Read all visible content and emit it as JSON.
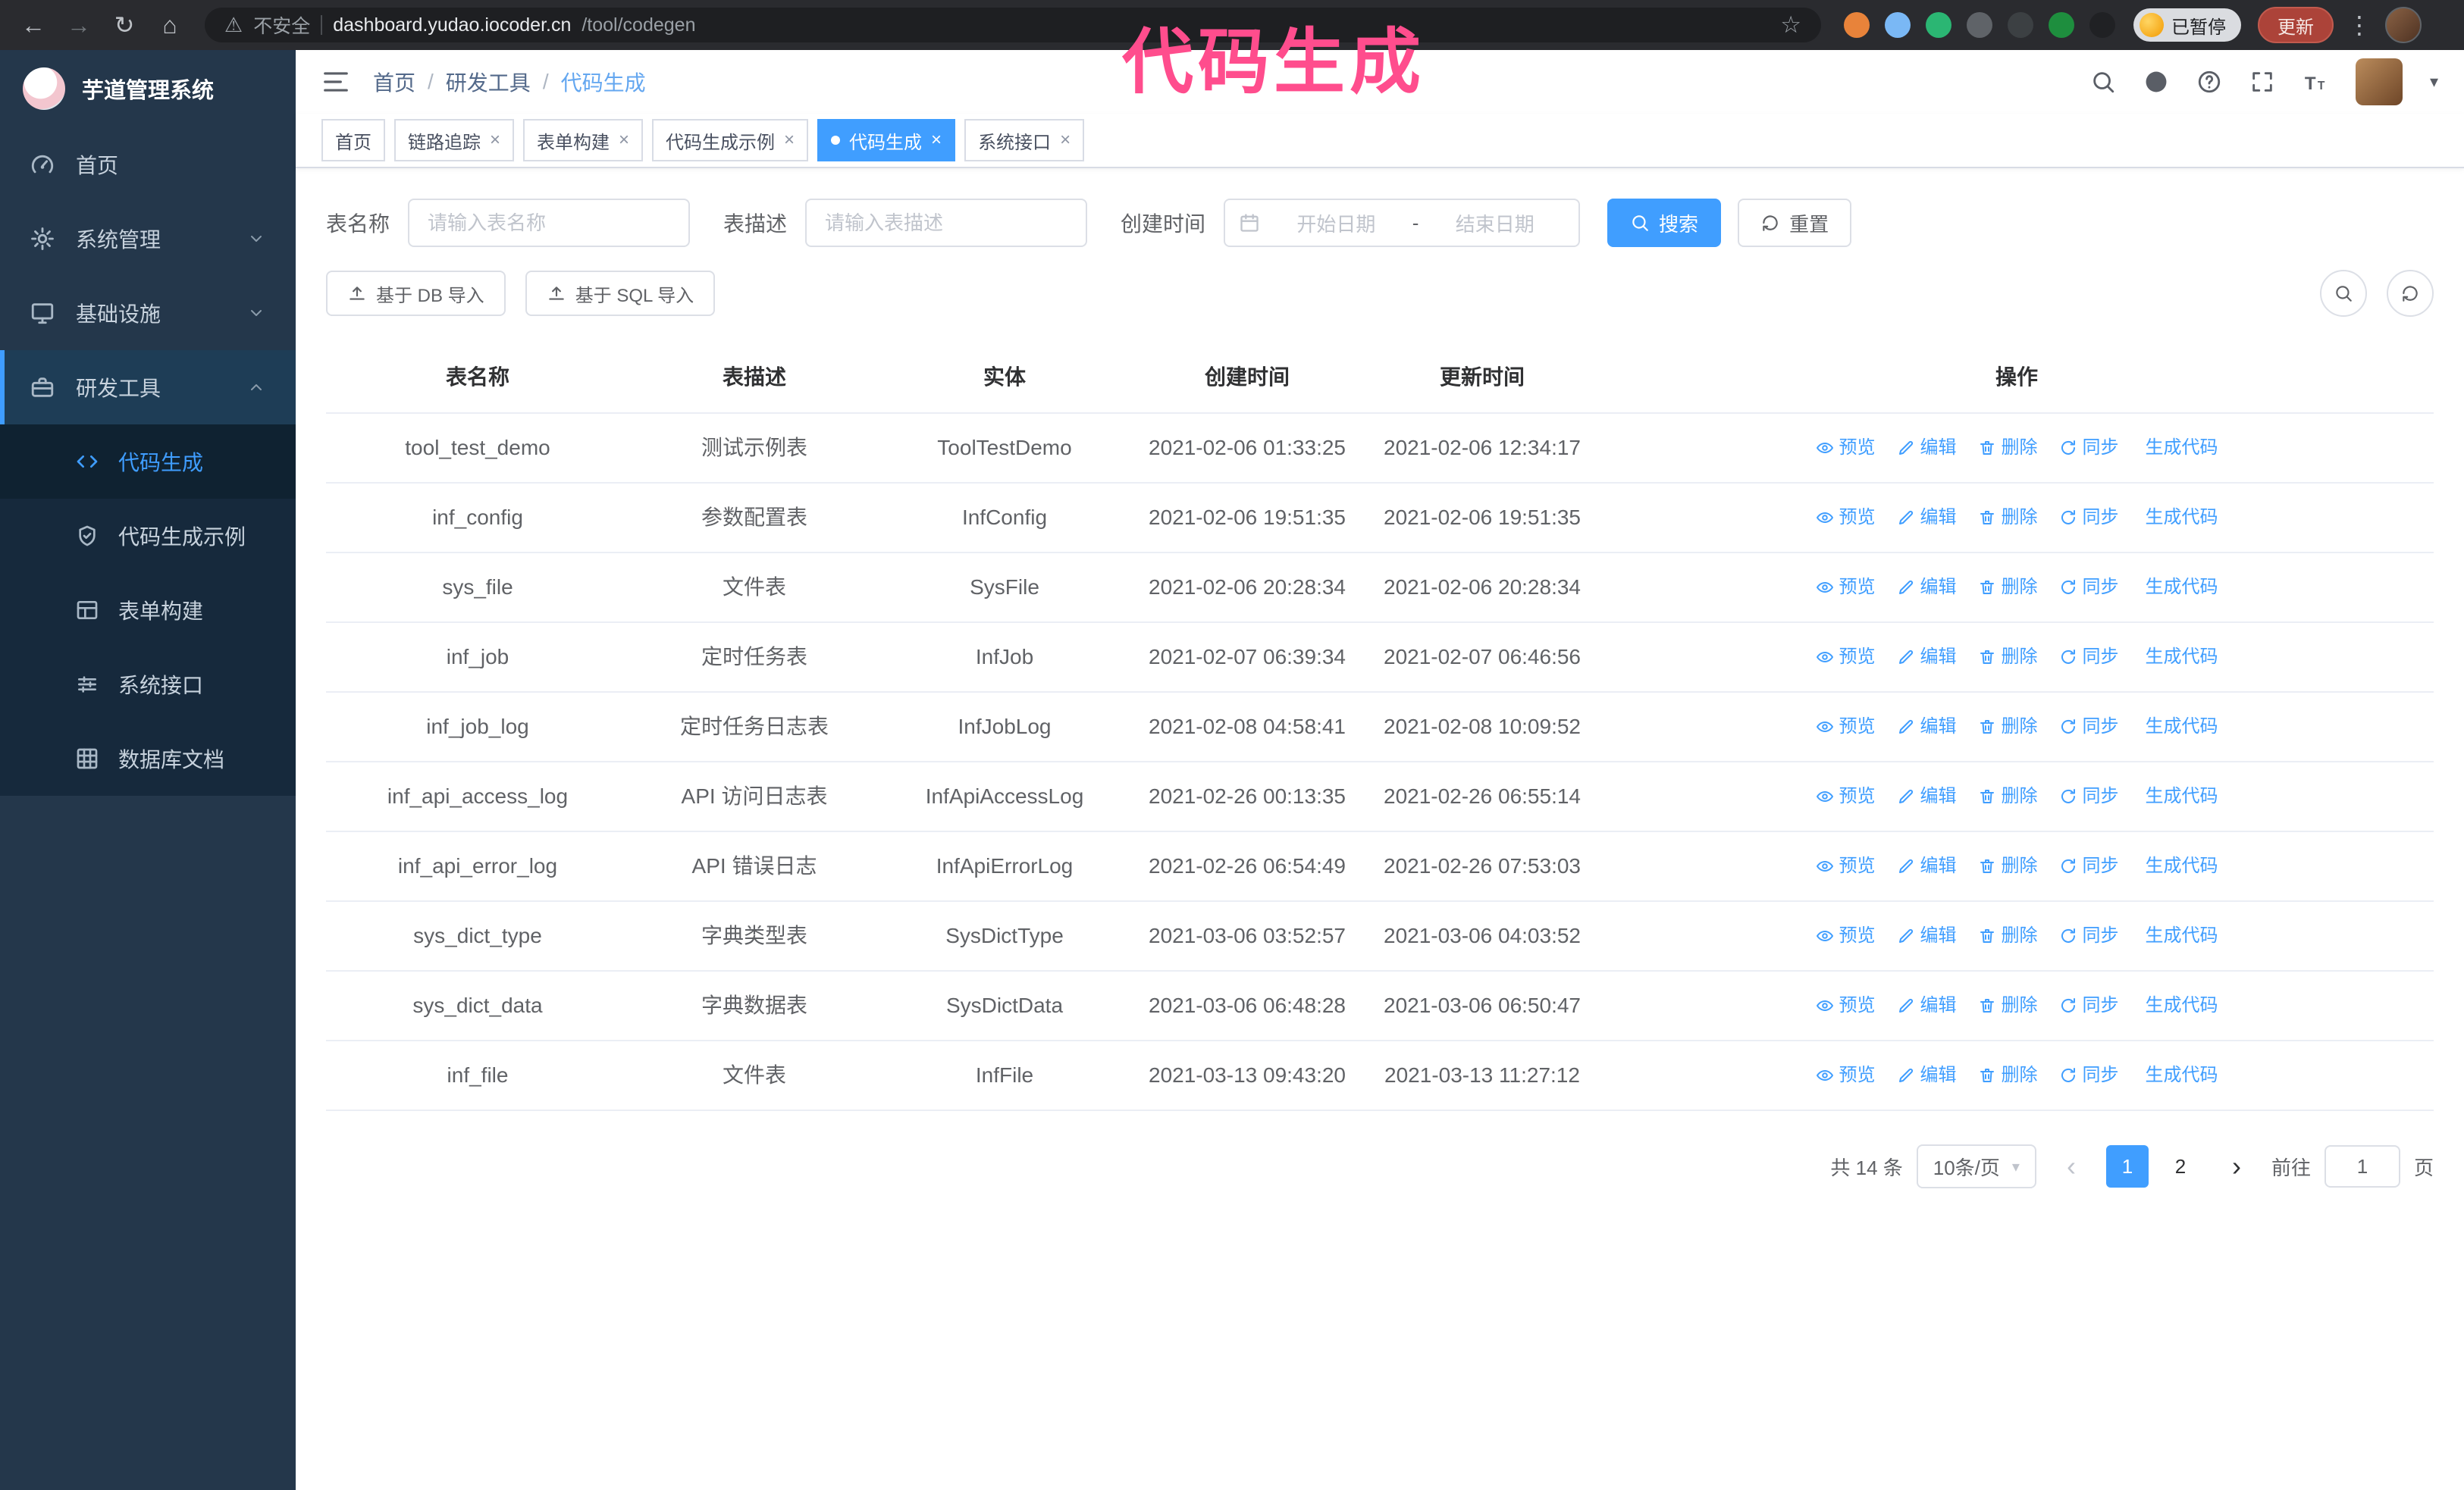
{
  "browser": {
    "nav_icons": [
      "back",
      "forward",
      "reload",
      "home"
    ],
    "security_label": "不安全",
    "url_host": "dashboard.yudao.iocoder.cn",
    "url_path": "/tool/codegen",
    "extensions": [
      {
        "name": "extension-orange",
        "color": "#e8833a"
      },
      {
        "name": "extension-lightblue",
        "color": "#7ab8f5"
      },
      {
        "name": "extension-green-check",
        "color": "#2bb673"
      },
      {
        "name": "extension-grid",
        "color": "#5f6368"
      },
      {
        "name": "extension-dark",
        "color": "#3c4043"
      },
      {
        "name": "extension-leaf",
        "color": "#1e8e3e"
      },
      {
        "name": "extension-pin",
        "color": "#202124"
      }
    ],
    "paused_badge": "已暂停",
    "update_button": "更新"
  },
  "overlay_title": "代码生成",
  "sidebar": {
    "logo_title": "芋道管理系统",
    "items": [
      {
        "label": "首页",
        "icon": "gauge"
      },
      {
        "label": "系统管理",
        "icon": "gear",
        "chevron": "down"
      },
      {
        "label": "基础设施",
        "icon": "monitor",
        "chevron": "down"
      },
      {
        "label": "研发工具",
        "icon": "toolbox",
        "chevron": "up",
        "expanded": true
      }
    ],
    "sub_items": [
      {
        "label": "代码生成",
        "icon": "code-tag",
        "active": true
      },
      {
        "label": "代码生成示例",
        "icon": "shield-check"
      },
      {
        "label": "表单构建",
        "icon": "form"
      },
      {
        "label": "系统接口",
        "icon": "sliders"
      },
      {
        "label": "数据库文档",
        "icon": "grid"
      }
    ]
  },
  "header": {
    "breadcrumb": [
      {
        "label": "首页"
      },
      {
        "label": "研发工具"
      },
      {
        "label": "代码生成",
        "current": true
      }
    ],
    "separator": "/",
    "right_icons": [
      "search",
      "github",
      "question",
      "fullscreen",
      "text-size"
    ]
  },
  "tabs": [
    {
      "label": "首页",
      "closable": false
    },
    {
      "label": "链路追踪",
      "closable": true
    },
    {
      "label": "表单构建",
      "closable": true
    },
    {
      "label": "代码生成示例",
      "closable": true
    },
    {
      "label": "代码生成",
      "closable": true,
      "active": true
    },
    {
      "label": "系统接口",
      "closable": true
    }
  ],
  "filters": {
    "table_name": {
      "label": "表名称",
      "placeholder": "请输入表名称",
      "value": ""
    },
    "table_desc": {
      "label": "表描述",
      "placeholder": "请输入表描述",
      "value": ""
    },
    "create_time": {
      "label": "创建时间",
      "start_placeholder": "开始日期",
      "separator": "-",
      "end_placeholder": "结束日期"
    },
    "search_button": "搜索",
    "reset_button": "重置"
  },
  "toolbar": {
    "import_db_button": "基于 DB 导入",
    "import_sql_button": "基于 SQL 导入"
  },
  "table": {
    "columns": [
      "表名称",
      "表描述",
      "实体",
      "创建时间",
      "更新时间",
      "操作"
    ],
    "row_actions": [
      {
        "name": "preview",
        "label": "预览",
        "icon": "eye"
      },
      {
        "name": "edit",
        "label": "编辑",
        "icon": "edit"
      },
      {
        "name": "delete",
        "label": "删除",
        "icon": "delete"
      },
      {
        "name": "sync",
        "label": "同步",
        "icon": "sync"
      },
      {
        "name": "generate-code",
        "label": "生成代码",
        "icon": "download"
      }
    ],
    "rows": [
      {
        "name": "tool_test_demo",
        "desc": "测试示例表",
        "entity": "ToolTestDemo",
        "created": "2021-02-06 01:33:25",
        "updated": "2021-02-06 12:34:17"
      },
      {
        "name": "inf_config",
        "desc": "参数配置表",
        "entity": "InfConfig",
        "created": "2021-02-06 19:51:35",
        "updated": "2021-02-06 19:51:35"
      },
      {
        "name": "sys_file",
        "desc": "文件表",
        "entity": "SysFile",
        "created": "2021-02-06 20:28:34",
        "updated": "2021-02-06 20:28:34"
      },
      {
        "name": "inf_job",
        "desc": "定时任务表",
        "entity": "InfJob",
        "created": "2021-02-07 06:39:34",
        "updated": "2021-02-07 06:46:56"
      },
      {
        "name": "inf_job_log",
        "desc": "定时任务日志表",
        "entity": "InfJobLog",
        "created": "2021-02-08 04:58:41",
        "updated": "2021-02-08 10:09:52"
      },
      {
        "name": "inf_api_access_log",
        "desc": "API 访问日志表",
        "entity": "InfApiAccessLog",
        "created": "2021-02-26 00:13:35",
        "updated": "2021-02-26 06:55:14"
      },
      {
        "name": "inf_api_error_log",
        "desc": "API 错误日志",
        "entity": "InfApiErrorLog",
        "created": "2021-02-26 06:54:49",
        "updated": "2021-02-26 07:53:03"
      },
      {
        "name": "sys_dict_type",
        "desc": "字典类型表",
        "entity": "SysDictType",
        "created": "2021-03-06 03:52:57",
        "updated": "2021-03-06 04:03:52"
      },
      {
        "name": "sys_dict_data",
        "desc": "字典数据表",
        "entity": "SysDictData",
        "created": "2021-03-06 06:48:28",
        "updated": "2021-03-06 06:50:47"
      },
      {
        "name": "inf_file",
        "desc": "文件表",
        "entity": "InfFile",
        "created": "2021-03-13 09:43:20",
        "updated": "2021-03-13 11:27:12"
      }
    ]
  },
  "pagination": {
    "total_text": "共 14 条",
    "page_size": "10条/页",
    "pages": [
      "1",
      "2"
    ],
    "active_page": "1",
    "goto_label": "前往",
    "goto_value": "1",
    "page_unit": "页"
  },
  "colors": {
    "accent": "#409EFF",
    "sidebar_bg": "#24374b",
    "submenu_bg": "#16293c",
    "active_text": "#3f9dff",
    "overlay_pink": "#ff4d8d",
    "update_button_red": "#ac4339"
  }
}
